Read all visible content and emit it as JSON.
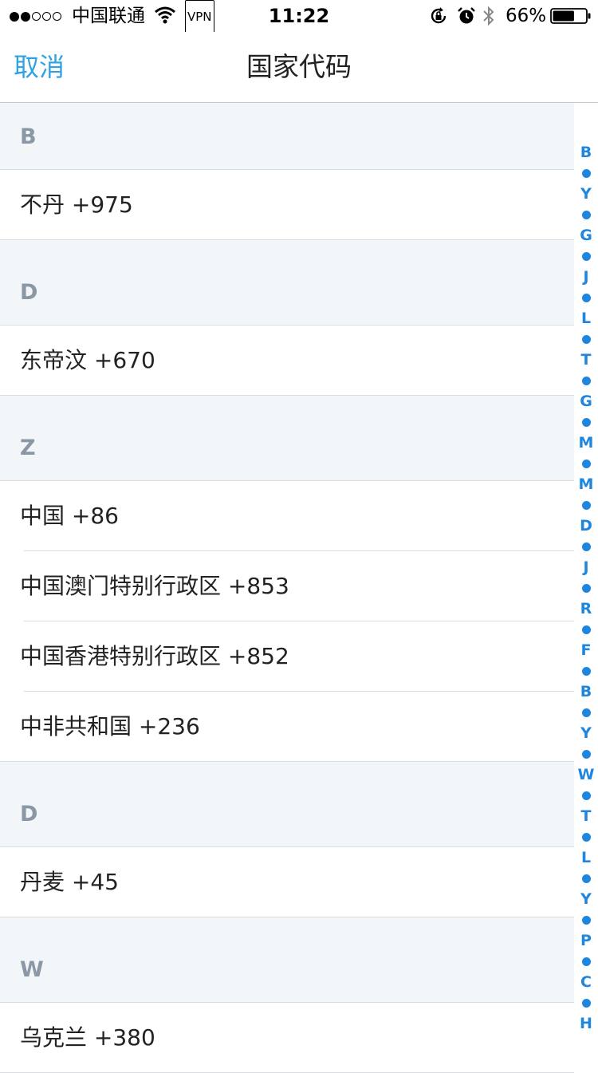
{
  "status_bar": {
    "carrier": "中国联通",
    "vpn": "VPN",
    "time": "11:22",
    "battery": "66%",
    "battery_level": 0.66
  },
  "nav": {
    "cancel_label": "取消",
    "title": "国家代码"
  },
  "sections": [
    {
      "letter": "B",
      "rows": [
        "不丹 +975"
      ]
    },
    {
      "letter": "D",
      "rows": [
        "东帝汶 +670"
      ]
    },
    {
      "letter": "Z",
      "rows": [
        "中国 +86",
        "中国澳门特别行政区 +853",
        "中国香港特别行政区 +852",
        "中非共和国 +236"
      ]
    },
    {
      "letter": "D",
      "rows": [
        "丹麦 +45"
      ]
    },
    {
      "letter": "W",
      "rows": [
        "乌克兰 +380"
      ]
    }
  ],
  "index_letters": [
    "B",
    "Y",
    "G",
    "J",
    "L",
    "T",
    "G",
    "M",
    "M",
    "D",
    "J",
    "R",
    "F",
    "B",
    "Y",
    "W",
    "T",
    "L",
    "Y",
    "P",
    "C",
    "H"
  ],
  "colors": {
    "accent": "#2ea2e5",
    "index": "#1f86e0",
    "section_bg": "#f3f6f9",
    "section_text": "#8a98a6"
  }
}
